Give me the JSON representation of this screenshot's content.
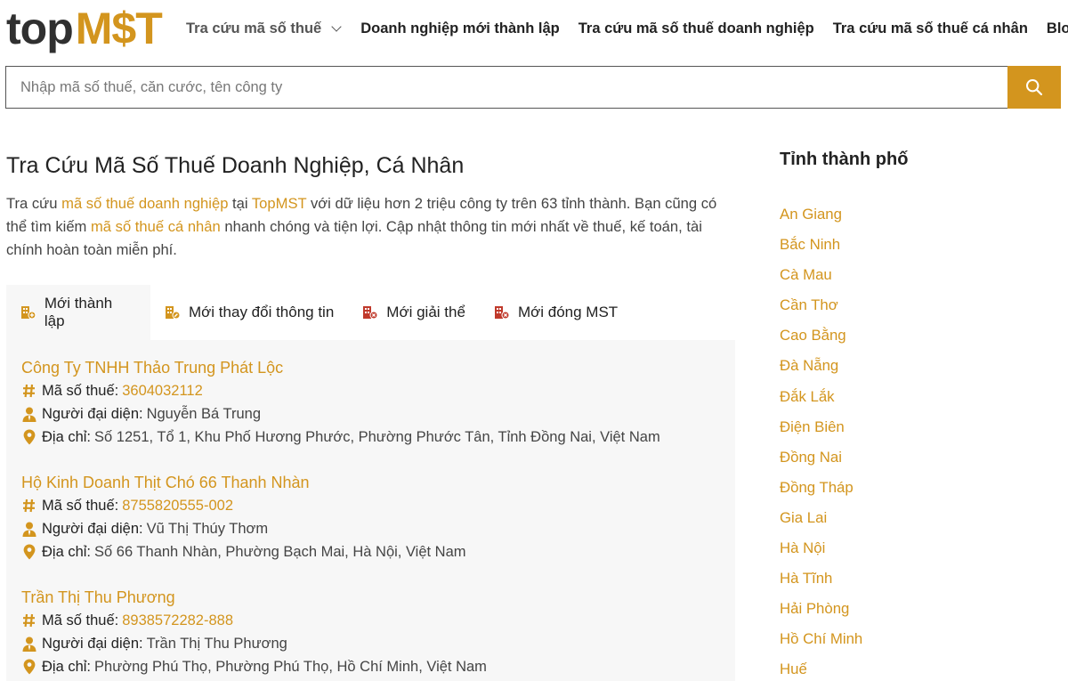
{
  "brand": {
    "logo_top": "top",
    "logo_mst": "M$T",
    "accent": "#d3951e"
  },
  "nav": {
    "items": [
      {
        "label": "Tra cứu mã số thuế"
      },
      {
        "label": "Doanh nghiệp mới thành lập"
      },
      {
        "label": "Tra cứu mã số thuế doanh nghiệp"
      },
      {
        "label": "Tra cứu mã số thuế cá nhân"
      },
      {
        "label": "Blog"
      }
    ]
  },
  "search": {
    "placeholder": "Nhập mã số thuế, căn cước, tên công ty",
    "icon": "search-icon"
  },
  "main": {
    "title": "Tra Cứu Mã Số Thuế Doanh Nghiệp, Cá Nhân",
    "intro": {
      "p1": "Tra cứu ",
      "link1": "mã số thuế doanh nghiệp",
      "p2": " tại ",
      "link2": "TopMST",
      "p3": " với dữ liệu hơn 2 triệu công ty trên 63 tỉnh thành. Bạn cũng có thể tìm kiếm ",
      "link3": "mã số thuế cá nhân",
      "p4": " nhanh chóng và tiện lợi. Cập nhật thông tin mới nhất về thuế, kế toán, tài chính hoàn toàn miễn phí."
    },
    "tabs": [
      {
        "label": "Mới thành lập",
        "icon": "building-plus-icon",
        "active": true
      },
      {
        "label": "Mới thay đổi thông tin",
        "icon": "building-edit-icon",
        "active": false
      },
      {
        "label": "Mới giải thể",
        "icon": "building-close-icon",
        "active": false
      },
      {
        "label": "Mới đóng MST",
        "icon": "building-close-icon",
        "active": false
      }
    ],
    "field_labels": {
      "tax": "Mã số thuế:",
      "rep": "Người đại diện:",
      "addr": "Địa chỉ:"
    },
    "companies": [
      {
        "name": "Công Ty TNHH Thảo Trung Phát Lộc",
        "tax_code": "3604032112",
        "representative": "Nguyễn Bá Trung",
        "address": "Số 1251, Tổ 1, Khu Phố Hương Phước, Phường Phước Tân, Tỉnh Đồng Nai, Việt Nam"
      },
      {
        "name": "Hộ Kinh Doanh Thịt Chó 66 Thanh Nhàn",
        "tax_code": "8755820555-002",
        "representative": "Vũ Thị Thúy Thơm",
        "address": "Số 66 Thanh Nhàn, Phường Bạch Mai, Hà Nội, Việt Nam"
      },
      {
        "name": "Trần Thị Thu Phương",
        "tax_code": "8938572282-888",
        "representative": "Trần Thị Thu Phương",
        "address": "Phường Phú Thọ, Phường Phú Thọ, Hồ Chí Minh, Việt Nam"
      }
    ]
  },
  "sidebar": {
    "title": "Tỉnh thành phố",
    "provinces": [
      "An Giang",
      "Bắc Ninh",
      "Cà Mau",
      "Cần Thơ",
      "Cao Bằng",
      "Đà Nẵng",
      "Đắk Lắk",
      "Điện Biên",
      "Đồng Nai",
      "Đồng Tháp",
      "Gia Lai",
      "Hà Nội",
      "Hà Tĩnh",
      "Hải Phòng",
      "Hồ Chí Minh",
      "Huế"
    ]
  }
}
